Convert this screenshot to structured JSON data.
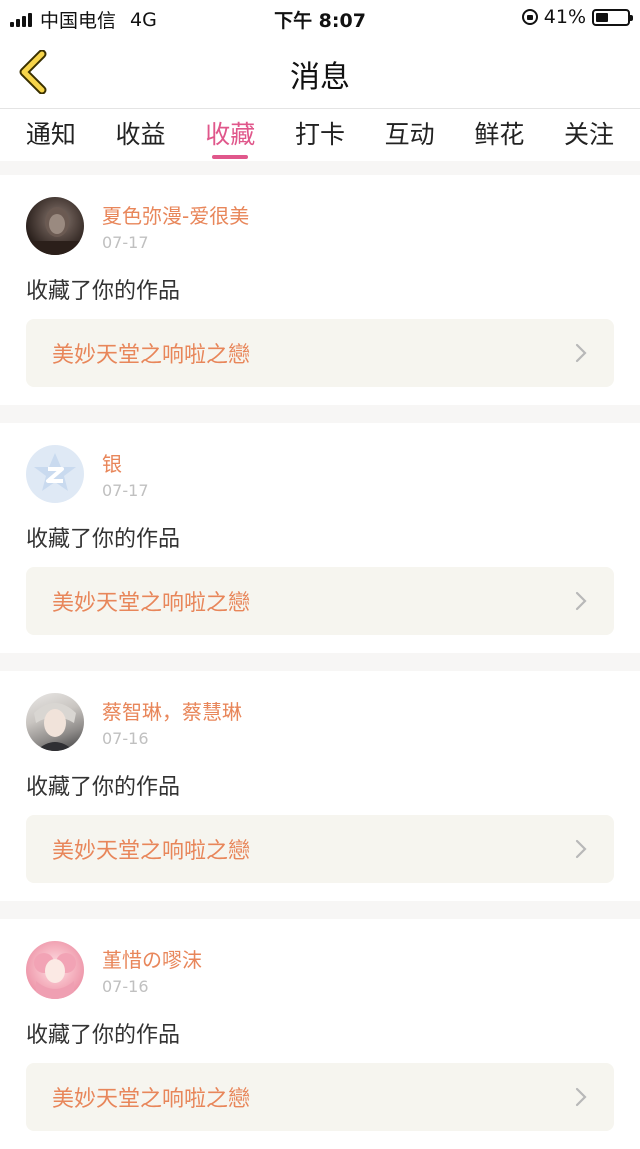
{
  "status": {
    "carrier": "中国电信",
    "network": "4G",
    "time": "下午 8:07",
    "battery": "41%",
    "battery_level": 0.41
  },
  "nav": {
    "title": "消息"
  },
  "tabs": [
    {
      "label": "通知"
    },
    {
      "label": "收益"
    },
    {
      "label": "收藏"
    },
    {
      "label": "打卡"
    },
    {
      "label": "互动"
    },
    {
      "label": "鲜花"
    },
    {
      "label": "关注"
    }
  ],
  "active_tab": "收藏",
  "colors": {
    "accent": "#e0578b",
    "name": "#e8865a",
    "card_link_bg": "#f6f5ef"
  },
  "messages": [
    {
      "user": "夏色弥漫-爱很美",
      "date": "07-17",
      "action": "收藏了你的作品",
      "work": "美妙天堂之响啦之戀",
      "avatar": "photo-avatar"
    },
    {
      "user": "银",
      "date": "07-17",
      "action": "收藏了你的作品",
      "work": "美妙天堂之响啦之戀",
      "avatar": "qq-default-avatar"
    },
    {
      "user": "蔡智琳，蔡慧琳",
      "date": "07-16",
      "action": "收藏了你的作品",
      "work": "美妙天堂之响啦之戀",
      "avatar": "anime-boy-avatar"
    },
    {
      "user": "堇惜の嘐沫",
      "date": "07-16",
      "action": "收藏了你的作品",
      "work": "美妙天堂之响啦之戀",
      "avatar": "anime-girl-avatar"
    }
  ]
}
